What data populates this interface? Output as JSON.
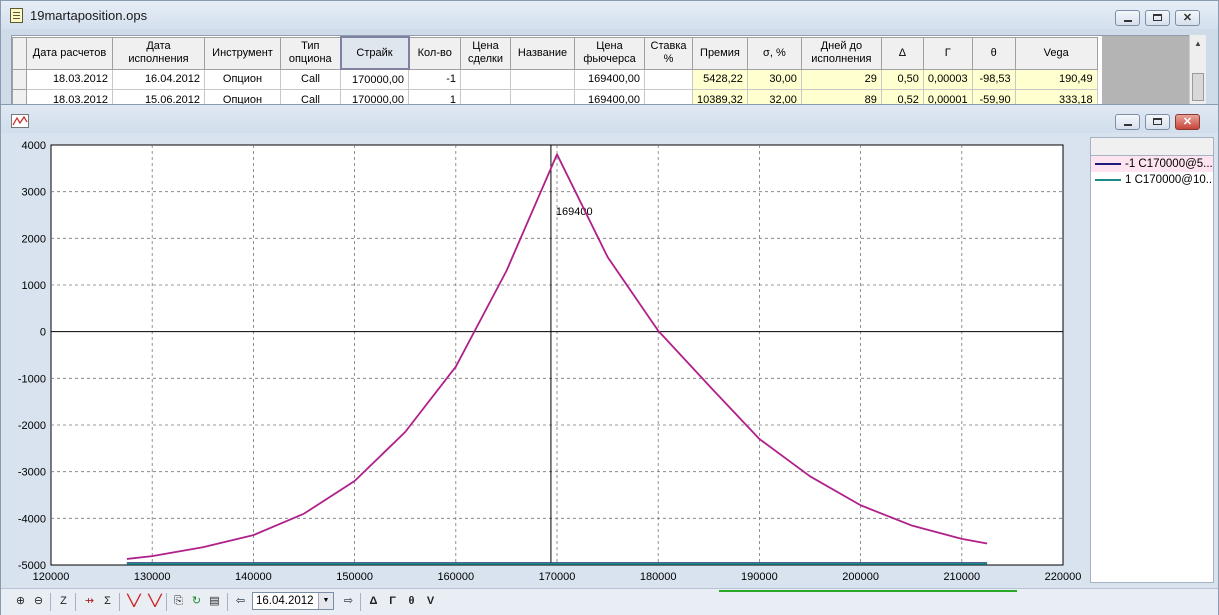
{
  "window_positions": {
    "title": "19martaposition.ops",
    "controls": {
      "minimize": "",
      "maximize": "",
      "close": "✕"
    }
  },
  "table": {
    "headers": [
      "Дата расчетов",
      "Дата исполнения",
      "Инструмент",
      "Тип опциона",
      "Страйк",
      "Кол-во",
      "Цена сделки",
      "Название",
      "Цена фьючерса",
      "Ставка %",
      "Премия",
      "σ, %",
      "Дней до исполнения",
      "Δ",
      "Γ",
      "θ",
      "Vega"
    ],
    "rows": [
      [
        "18.03.2012",
        "16.04.2012",
        "Опцион",
        "Call",
        "170000,00",
        "-1",
        "",
        "",
        "169400,00",
        "",
        "5428,22",
        "30,00",
        "29",
        "0,50",
        "0,00003",
        "-98,53",
        "190,49"
      ],
      [
        "18.03.2012",
        "15.06.2012",
        "Опцион",
        "Call",
        "170000,00",
        "1",
        "",
        "",
        "169400,00",
        "",
        "10389,32",
        "32,00",
        "89",
        "0,52",
        "0,00001",
        "-59,90",
        "333,18"
      ]
    ]
  },
  "window_chart": {
    "controls": {
      "minimize": "",
      "maximize": "",
      "close": "✕"
    }
  },
  "chart_data": {
    "type": "line",
    "title": "",
    "xlabel": "",
    "ylabel": "",
    "xlim": [
      120000,
      220000
    ],
    "ylim": [
      -5000,
      4000
    ],
    "x_ticks": [
      120000,
      130000,
      140000,
      150000,
      160000,
      170000,
      180000,
      190000,
      200000,
      210000,
      220000
    ],
    "y_ticks": [
      4000,
      3000,
      2000,
      1000,
      0,
      -1000,
      -2000,
      -3000,
      -4000,
      -5000
    ],
    "grid": true,
    "cursor": {
      "x": 169400,
      "label": "169400"
    },
    "series": [
      {
        "name": "-1 C170000@5...",
        "color": "#1c1c78",
        "x": [
          127500,
          212500
        ],
        "y": [
          -4960,
          -4960
        ]
      },
      {
        "name": "1 C170000@10...",
        "color": "#1a8a8a",
        "x": [
          127500,
          212500
        ],
        "y": [
          -4975,
          -4975
        ]
      },
      {
        "name": "",
        "color": "#b0208a",
        "x": [
          127500,
          130000,
          135000,
          140000,
          145000,
          150000,
          155000,
          160000,
          165000,
          170000,
          175000,
          180000,
          185000,
          190000,
          195000,
          200000,
          205000,
          210000,
          212500
        ],
        "y": [
          -4870,
          -4810,
          -4620,
          -4360,
          -3900,
          -3200,
          -2150,
          -750,
          1300,
          3800,
          1600,
          20,
          -1150,
          -2300,
          -3100,
          -3720,
          -4150,
          -4440,
          -4540
        ]
      }
    ],
    "legend": {
      "position": "right"
    }
  },
  "toolbar": {
    "date": "16.04.2012",
    "buttons": [
      "⊕",
      "⊖",
      "Z",
      "⇸",
      "Σ",
      "╲╱",
      "╲╱",
      "⎘",
      "↻",
      "▤",
      "⇦",
      "⇨",
      "Δ",
      "Γ",
      "θ",
      "V"
    ]
  }
}
